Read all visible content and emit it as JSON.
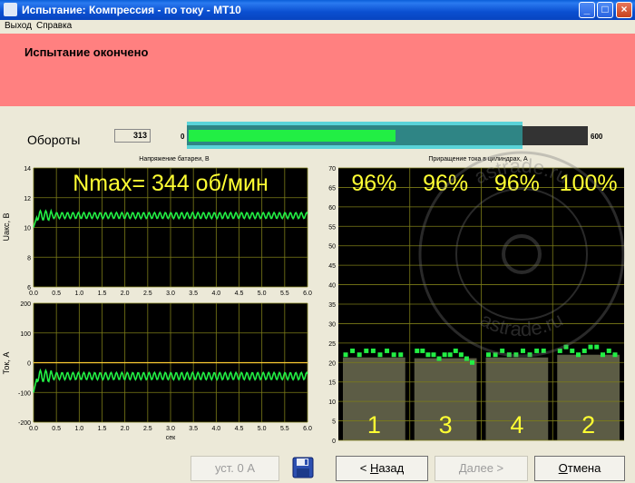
{
  "window": {
    "title": "Испытание: Компрессия - по току - МТ10",
    "minimize": "_",
    "maximize": "□",
    "close": "×"
  },
  "menu": {
    "items": [
      "Выход",
      "Справка"
    ]
  },
  "banner": {
    "message": "Испытание окончено",
    "color": "#ff8080"
  },
  "rpm": {
    "label": "Обороты",
    "value": "313",
    "min": "0",
    "max": "600",
    "fraction": 0.52
  },
  "footer": {
    "set_zero": "уст. 0 А",
    "back": "< Назад",
    "back_hotkey": "Н",
    "next": "Далее >",
    "cancel": "Отмена",
    "cancel_hotkey": "О",
    "save_icon": "floppy-disk-icon"
  },
  "watermark": {
    "text": "astrade.ru"
  },
  "chart_data": [
    {
      "type": "line",
      "title": "Напряжение батареи, В",
      "ylabel": "Uакс, В",
      "xlabel": "",
      "annotation": "Nmax= 344 об/мин",
      "x_ticks": [
        "0.0",
        "0.5",
        "1.0",
        "1.5",
        "2.0",
        "2.5",
        "3.0",
        "3.5",
        "4.0",
        "4.5",
        "5.0",
        "5.5",
        "6.0"
      ],
      "y_ticks": [
        "14",
        "12",
        "10",
        "8",
        "6"
      ],
      "xlim": [
        0,
        6
      ],
      "ylim": [
        6,
        14
      ],
      "series": [
        {
          "color": "#22ee44",
          "start": 10.0,
          "level": 10.8,
          "ripple": 0.2
        }
      ],
      "grid": true
    },
    {
      "type": "line",
      "title": "",
      "ylabel": "Ток, А",
      "xlabel": "сек",
      "x_ticks": [
        "0.0",
        "0.5",
        "1.0",
        "1.5",
        "2.0",
        "2.5",
        "3.0",
        "3.5",
        "4.0",
        "4.5",
        "5.0",
        "5.5",
        "6.0"
      ],
      "y_ticks": [
        "200",
        "100",
        "0",
        "-100",
        "-200"
      ],
      "xlim": [
        0,
        6
      ],
      "ylim": [
        -200,
        200
      ],
      "series": [
        {
          "color": "#22ee44",
          "start": -100,
          "level": -45,
          "ripple": 12
        }
      ],
      "zero_line_color": "#ffcc33",
      "grid": true
    },
    {
      "type": "bar",
      "title": "Приращение тока в цилиндрах, А",
      "y_ticks": [
        "70",
        "65",
        "60",
        "55",
        "50",
        "45",
        "40",
        "35",
        "30",
        "25",
        "20",
        "15",
        "10",
        "5",
        "0"
      ],
      "ylim": [
        0,
        70
      ],
      "categories": [
        "1",
        "3",
        "4",
        "2"
      ],
      "percent_labels": [
        "96%",
        "96%",
        "96%",
        "100%"
      ],
      "values": [
        21.3,
        21.1,
        21.3,
        22.0
      ],
      "points": [
        [
          22,
          23,
          22,
          23,
          23,
          22,
          23,
          22,
          22
        ],
        [
          23,
          23,
          22,
          22,
          21,
          22,
          22,
          23,
          22,
          21,
          20
        ],
        [
          22,
          22,
          23,
          22,
          22,
          23,
          22,
          23,
          23
        ],
        [
          23,
          24,
          23,
          22,
          23,
          24,
          24,
          22,
          23,
          22
        ]
      ],
      "bar_color": "#5c5c45",
      "point_color": "#22ee44",
      "grid": true
    }
  ]
}
